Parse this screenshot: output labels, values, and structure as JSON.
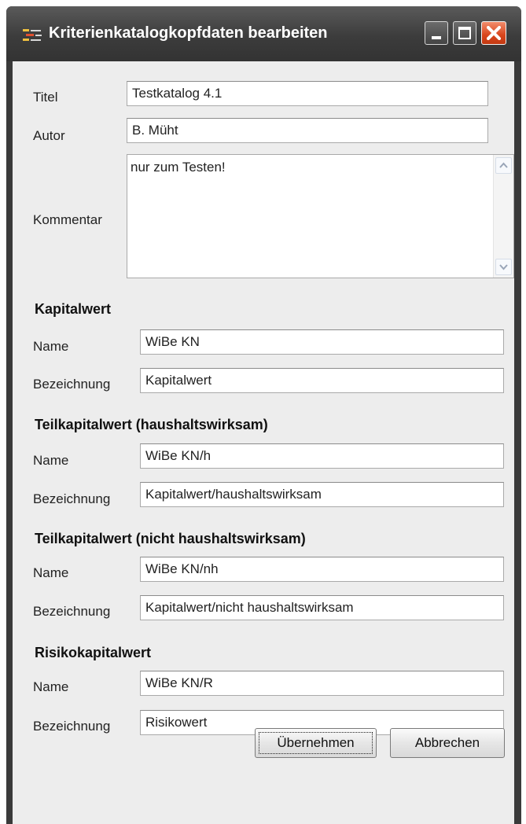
{
  "window": {
    "title": "Kriterienkatalogkopfdaten bearbeiten"
  },
  "header_fields": {
    "titel_label": "Titel",
    "titel_value": "Testkatalog 4.1",
    "autor_label": "Autor",
    "autor_value": "B. Müht",
    "kommentar_label": "Kommentar",
    "kommentar_value": "nur zum Testen!"
  },
  "sections": [
    {
      "heading": "Kapitalwert",
      "name_label": "Name",
      "name_value": "WiBe KN",
      "bezeichnung_label": "Bezeichnung",
      "bezeichnung_value": "Kapitalwert"
    },
    {
      "heading": "Teilkapitalwert (haushaltswirksam)",
      "name_label": "Name",
      "name_value": "WiBe KN/h",
      "bezeichnung_label": "Bezeichnung",
      "bezeichnung_value": "Kapitalwert/haushaltswirksam"
    },
    {
      "heading": "Teilkapitalwert (nicht haushaltswirksam)",
      "name_label": "Name",
      "name_value": "WiBe KN/nh",
      "bezeichnung_label": "Bezeichnung",
      "bezeichnung_value": "Kapitalwert/nicht haushaltswirksam"
    },
    {
      "heading": "Risikokapitalwert",
      "name_label": "Name",
      "name_value": "WiBe KN/R",
      "bezeichnung_label": "Bezeichnung",
      "bezeichnung_value": "Risikowert"
    }
  ],
  "buttons": {
    "ok": "Übernehmen",
    "cancel": "Abbrechen"
  },
  "colors": {
    "titlebar": "#3c3c3c",
    "client_bg": "#ededed",
    "close_button": "#d9451c"
  },
  "icons": [
    "app-icon",
    "minimize-icon",
    "maximize-icon",
    "close-icon",
    "scroll-up-icon",
    "scroll-down-icon"
  ]
}
